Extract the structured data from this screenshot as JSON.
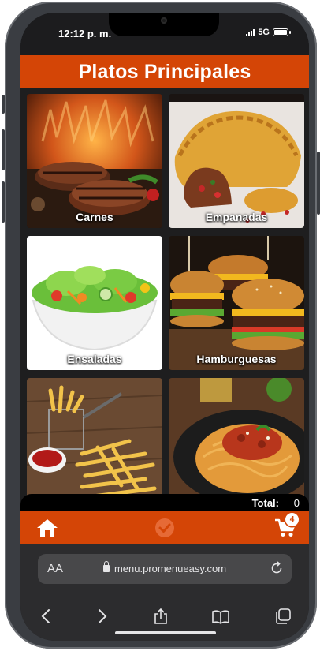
{
  "status_bar": {
    "time": "12:12 p. m.",
    "network": "5G"
  },
  "header": {
    "title": "Platos Principales"
  },
  "categories": [
    {
      "label": "Carnes"
    },
    {
      "label": "Empanadas"
    },
    {
      "label": "Ensaladas"
    },
    {
      "label": "Hamburguesas"
    },
    {
      "label": ""
    },
    {
      "label": ""
    }
  ],
  "total": {
    "label": "Total:",
    "value": "0"
  },
  "nav": {
    "cart_count": "4"
  },
  "browser": {
    "text_size": "AA",
    "url": "menu.promenueasy.com"
  },
  "colors": {
    "brand": "#d44506",
    "dark": "#1e1e1f"
  },
  "icons": [
    "home-icon",
    "check-circle-icon",
    "cart-icon",
    "lock-icon",
    "reload-icon",
    "back-icon",
    "forward-icon",
    "share-icon",
    "bookmarks-icon",
    "tabs-icon"
  ]
}
